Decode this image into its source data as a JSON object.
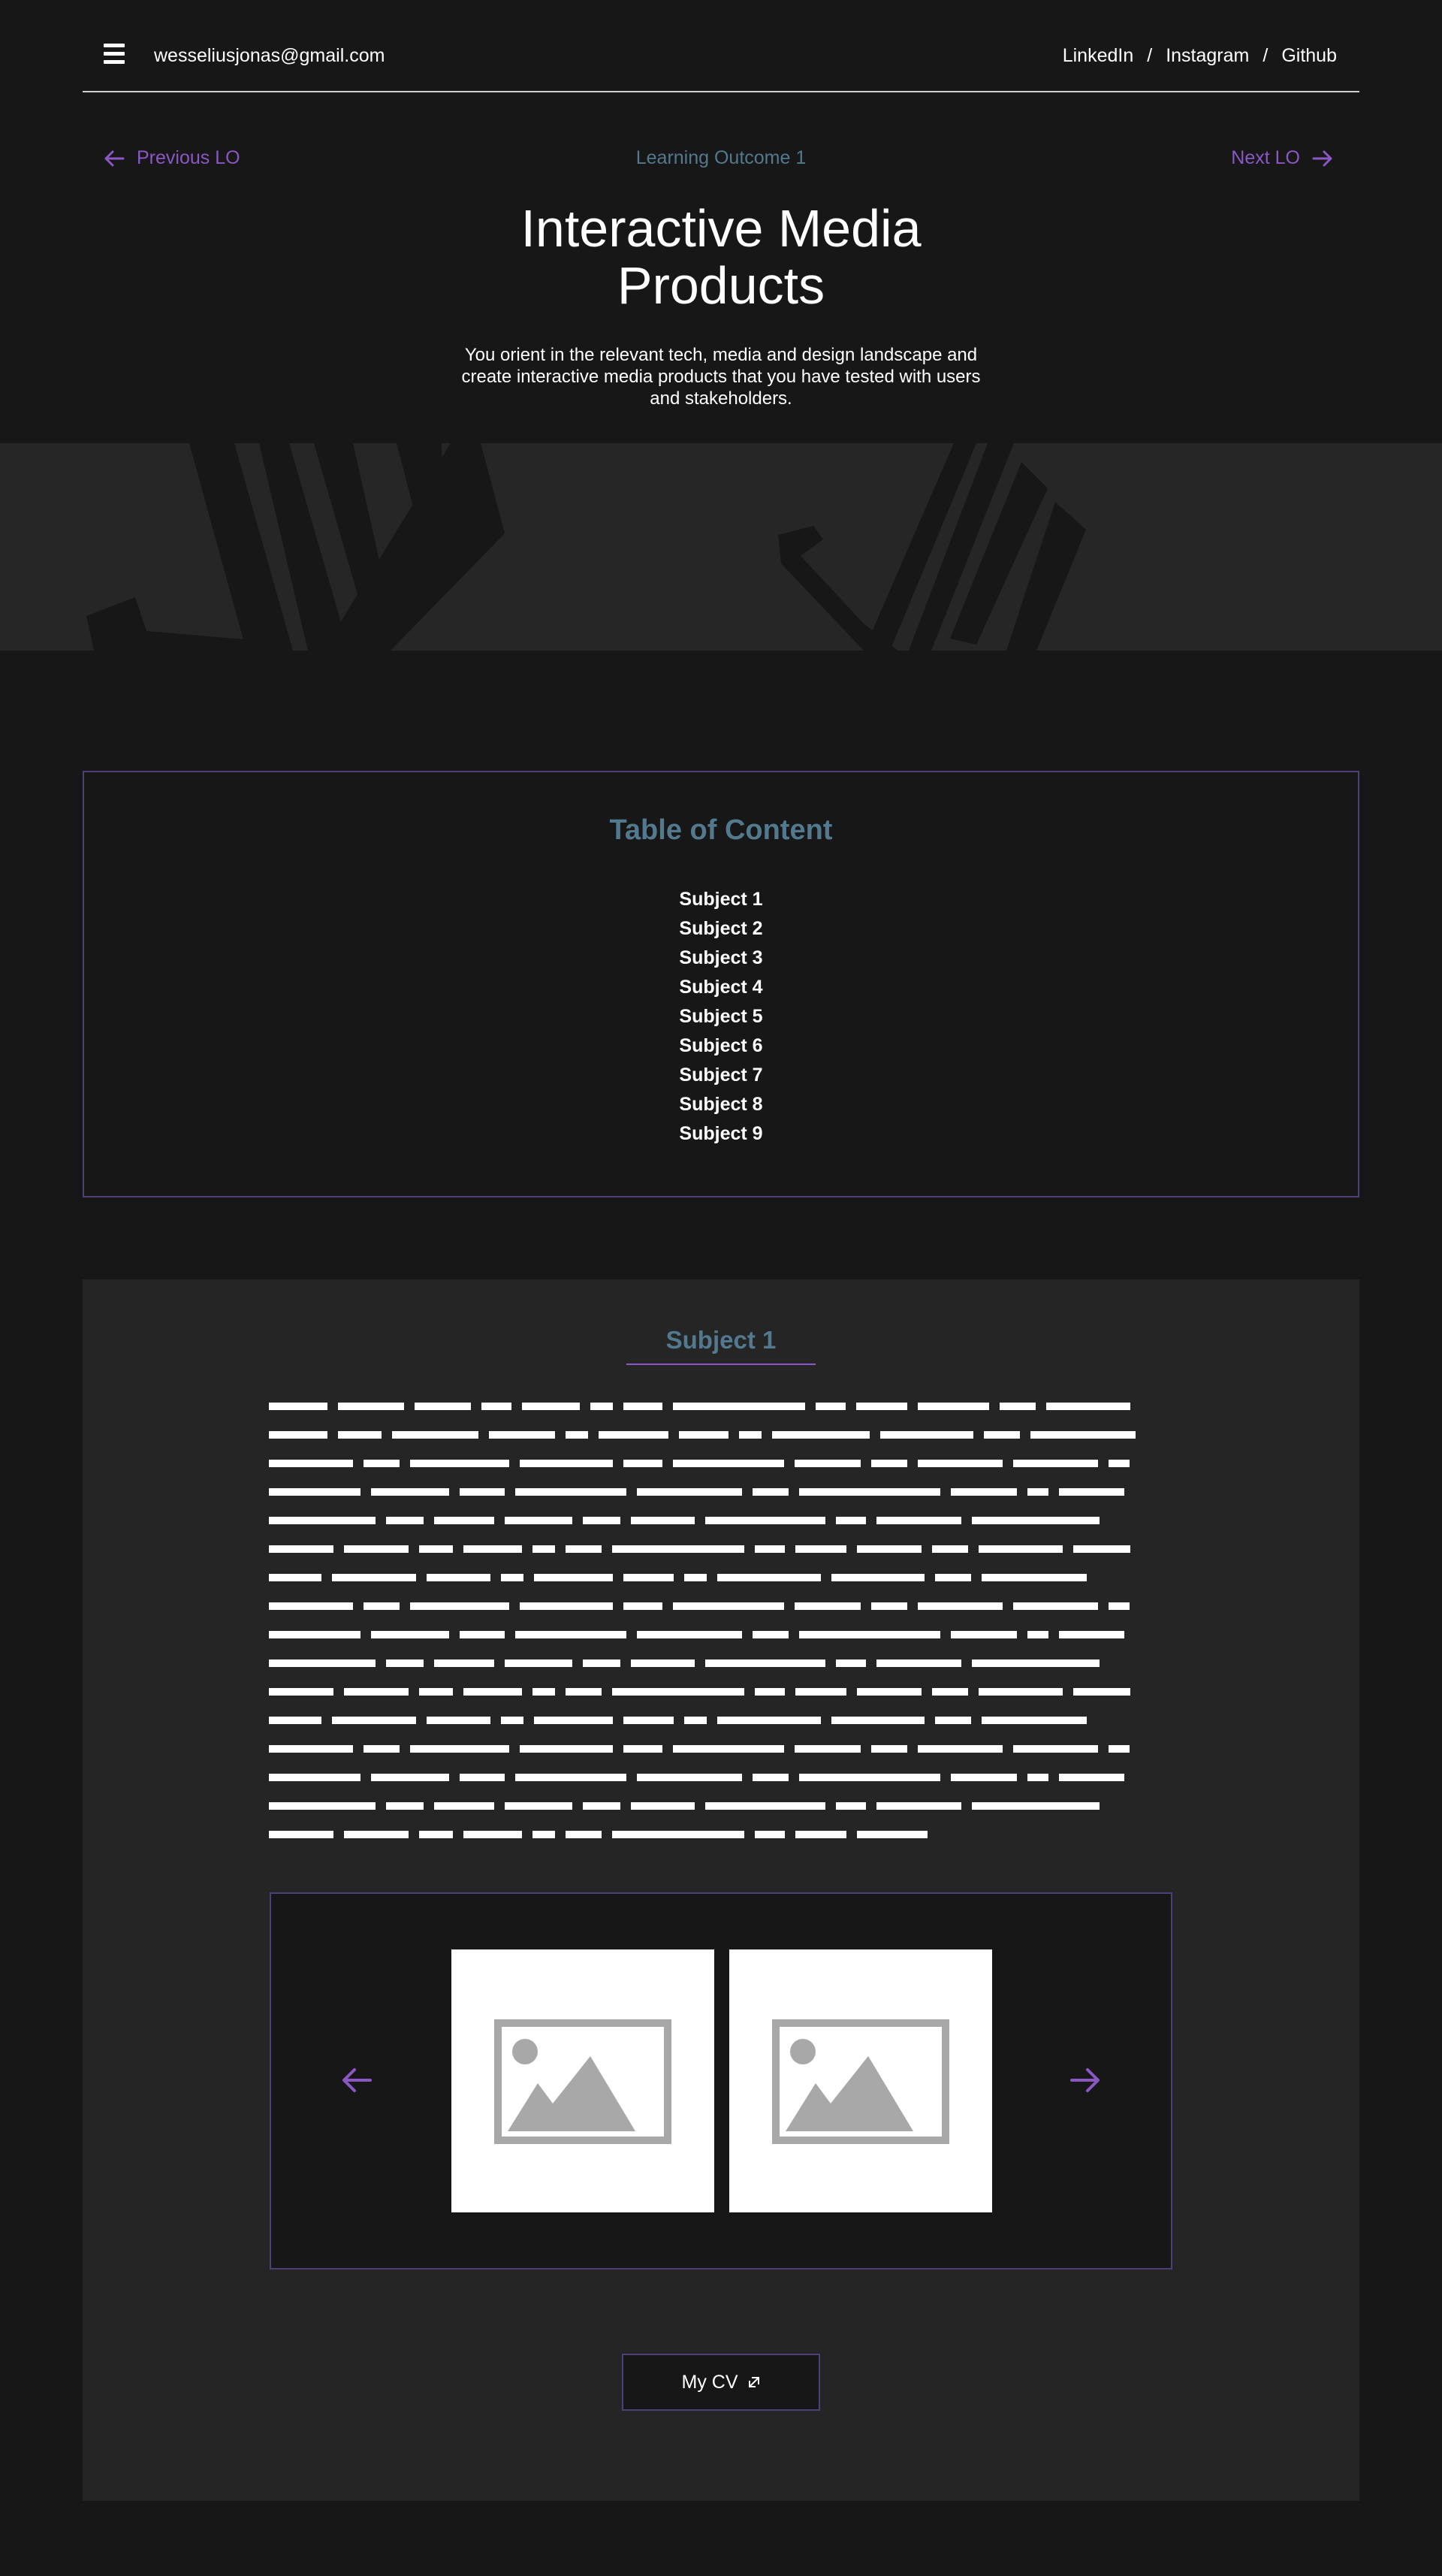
{
  "header": {
    "email": "wesseliusjonas@gmail.com",
    "social": [
      "LinkedIn",
      "Instagram",
      "Github"
    ],
    "separator": "/"
  },
  "lo_nav": {
    "prev_label": "Previous LO",
    "current_label": "Learning Outcome 1",
    "next_label": "Next LO"
  },
  "hero": {
    "title": "Interactive Media Products",
    "subtitle": "You orient in the relevant tech, media and design landscape and create interactive media products that you have tested with users and stakeholders."
  },
  "toc": {
    "title": "Table of Content",
    "items": [
      "Subject 1",
      "Subject 2",
      "Subject 3",
      "Subject 4",
      "Subject 5",
      "Subject 6",
      "Subject 7",
      "Subject 8",
      "Subject 9"
    ]
  },
  "subject": {
    "title": "Subject 1",
    "cv_button": "My CV"
  },
  "icons": {
    "menu": "hamburger-menu-icon",
    "prev": "arrow-left-icon",
    "next": "arrow-right-icon",
    "image": "image-placeholder-icon",
    "external": "external-link-icon"
  },
  "colors": {
    "background": "#171717",
    "panel": "#252525",
    "accent": "#8b57c4",
    "heading": "#53798f",
    "border": "#4f3f78"
  }
}
